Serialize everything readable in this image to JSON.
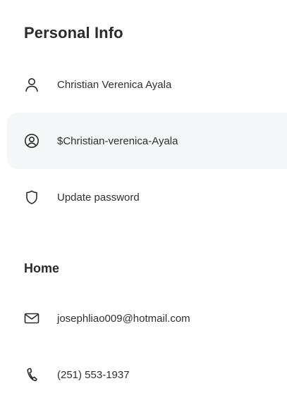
{
  "personal_info": {
    "title": "Personal Info",
    "items": [
      {
        "label": "Christian Verenica Ayala",
        "icon": "person-icon"
      },
      {
        "label": "$Christian-verenica-Ayala",
        "icon": "user-circle-icon"
      },
      {
        "label": "Update password",
        "icon": "shield-icon"
      }
    ]
  },
  "home": {
    "title": "Home",
    "items": [
      {
        "label": "josephliao009@hotmail.com",
        "icon": "mail-icon"
      },
      {
        "label": "(251) 553-1937",
        "icon": "phone-icon"
      }
    ]
  },
  "colors": {
    "text": "#2b2b2b",
    "active_row_bg": "#f6f7f9",
    "icon_stroke": "#2b2b2b"
  }
}
